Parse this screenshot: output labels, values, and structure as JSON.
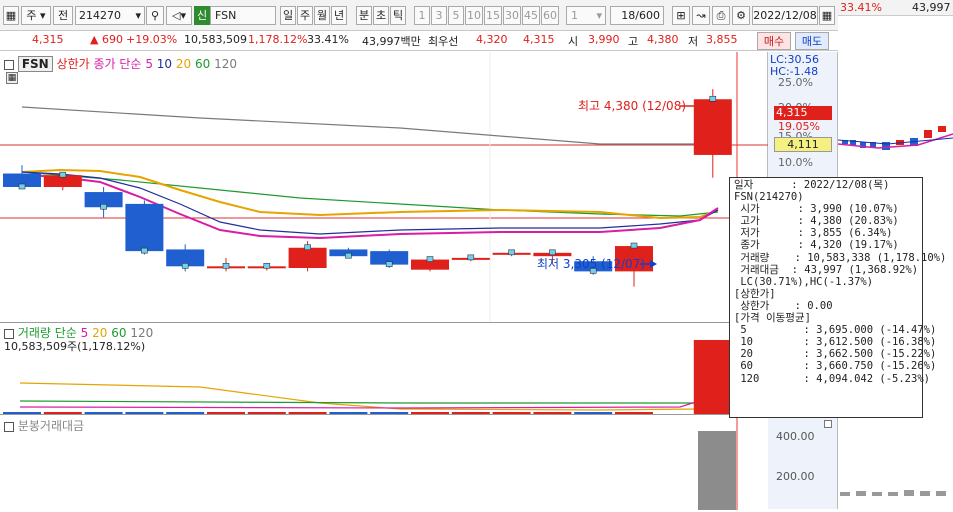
{
  "toolbar": {
    "period_code": "주",
    "prev_label": "전",
    "code": "214270",
    "credit_badge": "신",
    "name": "FSN",
    "tabs": [
      "일",
      "주",
      "월",
      "년",
      "분",
      "초",
      "틱"
    ],
    "active_tab": "일",
    "intervals": [
      "1",
      "3",
      "5",
      "10",
      "15",
      "30",
      "45",
      "60"
    ],
    "interval_count": "1",
    "page": "18/600",
    "date": "2022/12/08"
  },
  "quote": {
    "price": "4,315",
    "change": "▲  690",
    "change_pct": "+19.03%",
    "volume": "10,583,509",
    "volume_pct": "1,178.12%",
    "turnover": "33.41%",
    "amount": "43,997백만",
    "best_bid_label": "최우선",
    "best_ask": "4,320",
    "best_bid": "4,315",
    "open_label": "시",
    "open": "3,990",
    "high_label": "고",
    "high": "4,380",
    "low_label": "저",
    "low": "3,855",
    "buy_label": "매수",
    "sell_label": "매도"
  },
  "legend": {
    "ticker": "FSN",
    "upper_limit": "상한가",
    "close_ma": "종가 단순",
    "ma_periods": [
      "5",
      "10",
      "20",
      "60",
      "120"
    ],
    "ma_colors": [
      "#d81ea5",
      "#1f2f9e",
      "#e6a400",
      "#1f9a2e",
      "#7a7a7a"
    ]
  },
  "volume_legend": {
    "title": "거래량 단순",
    "ma_periods": [
      "5",
      "20",
      "60",
      "120"
    ],
    "ma_colors": [
      "#d81ea5",
      "#e6a400",
      "#1f9a2e",
      "#7a7a7a"
    ],
    "current": "10,583,509주(1,178.12%)"
  },
  "amount_legend": {
    "title": "분봉거래대금"
  },
  "annotations": {
    "high": "최고 4,380 (12/08)",
    "low": "최저 3,305 (12/07)"
  },
  "price_scale": {
    "lc": "LC:30.56",
    "hc": "HC:-1.48",
    "ticks": [
      "25.0%",
      "20.0%",
      "19.05%",
      "15.0%",
      "10.0%"
    ],
    "current_price": "4,315",
    "ref_price": "4,111"
  },
  "amount_scale": {
    "ticks": [
      "400.00",
      "200.00"
    ]
  },
  "tooltip": {
    "lines": [
      "일자      : 2022/12/08(목)",
      "FSN(214270)",
      " 시가      : 3,990 (10.07%)",
      " 고가      : 4,380 (20.83%)",
      " 저가      : 3,855 (6.34%)",
      " 종가      : 4,320 (19.17%)",
      " 거래량    : 10,583,338 (1,178.10%)",
      " 거래대금  : 43,997 (1,368.92%)",
      " LC(30.71%),HC(-1.37%)",
      "[상한가]",
      " 상한가    : 0.00",
      "[가격 이동평균]",
      " 5         : 3,695.000 (-14.47%)",
      " 10        : 3,612.500 (-16.38%)",
      " 20        : 3,662.500 (-15.22%)",
      " 60        : 3,660.750 (-15.26%)",
      " 120       : 4,094.042 (-5.23%)"
    ]
  },
  "side_panel": {
    "pct": "33.41%",
    "value": "43,997"
  },
  "chart_data": {
    "type": "candlestick",
    "ticker": "FSN",
    "candles": [
      {
        "o": 3880,
        "h": 3930,
        "l": 3800,
        "c": 3800
      },
      {
        "o": 3800,
        "h": 3880,
        "l": 3780,
        "c": 3870
      },
      {
        "o": 3770,
        "h": 3800,
        "l": 3620,
        "c": 3680
      },
      {
        "o": 3700,
        "h": 3720,
        "l": 3400,
        "c": 3420
      },
      {
        "o": 3430,
        "h": 3460,
        "l": 3300,
        "c": 3330
      },
      {
        "o": 3330,
        "h": 3380,
        "l": 3300,
        "c": 3330
      },
      {
        "o": 3330,
        "h": 3350,
        "l": 3305,
        "c": 3330
      },
      {
        "o": 3320,
        "h": 3480,
        "l": 3300,
        "c": 3440
      },
      {
        "o": 3430,
        "h": 3440,
        "l": 3380,
        "c": 3390
      },
      {
        "o": 3420,
        "h": 3430,
        "l": 3320,
        "c": 3340
      },
      {
        "o": 3310,
        "h": 3380,
        "l": 3300,
        "c": 3370
      },
      {
        "o": 3380,
        "h": 3400,
        "l": 3360,
        "c": 3380
      },
      {
        "o": 3400,
        "h": 3420,
        "l": 3390,
        "c": 3410
      },
      {
        "o": 3390,
        "h": 3420,
        "l": 3350,
        "c": 3410
      },
      {
        "o": 3360,
        "h": 3390,
        "l": 3280,
        "c": 3300
      },
      {
        "o": 3300,
        "h": 3470,
        "l": 3210,
        "c": 3450
      },
      {
        "o": 3990,
        "h": 4380,
        "l": 3855,
        "c": 4320
      }
    ],
    "volumes": [
      0.3,
      0.28,
      0.25,
      0.3,
      0.26,
      0.24,
      0.25,
      0.3,
      0.27,
      0.25,
      0.24,
      0.24,
      0.22,
      0.23,
      0.26,
      0.4,
      10.58
    ],
    "amount_bar": 10.58
  }
}
